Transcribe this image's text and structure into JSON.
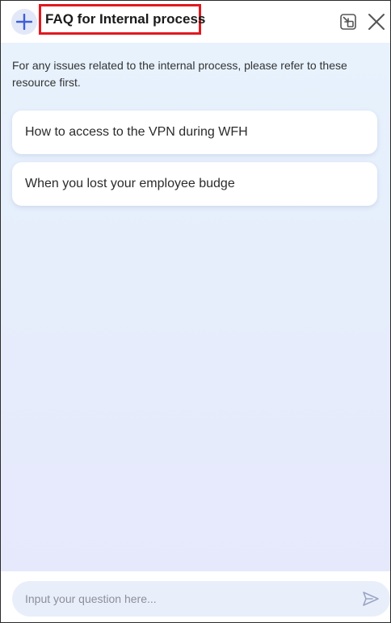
{
  "header": {
    "title": "FAQ for Internal process",
    "add_icon": "plus-icon",
    "minimize_icon": "minimize-window-icon",
    "close_icon": "close-icon"
  },
  "main": {
    "intro_text": "For any issues related to the internal process, please refer to these resource first.",
    "faq_items": [
      {
        "label": "How to access to the VPN during WFH"
      },
      {
        "label": "When you lost your employee budge"
      }
    ]
  },
  "footer": {
    "input_placeholder": "Input your question here...",
    "input_value": "",
    "send_icon": "send-icon"
  },
  "colors": {
    "accent": "#3e5fd9",
    "highlight_border": "#e0191f",
    "content_bg_top": "#e7f2fd",
    "content_bg_bottom": "#e6e9fc",
    "input_bg": "#e9eefb"
  }
}
